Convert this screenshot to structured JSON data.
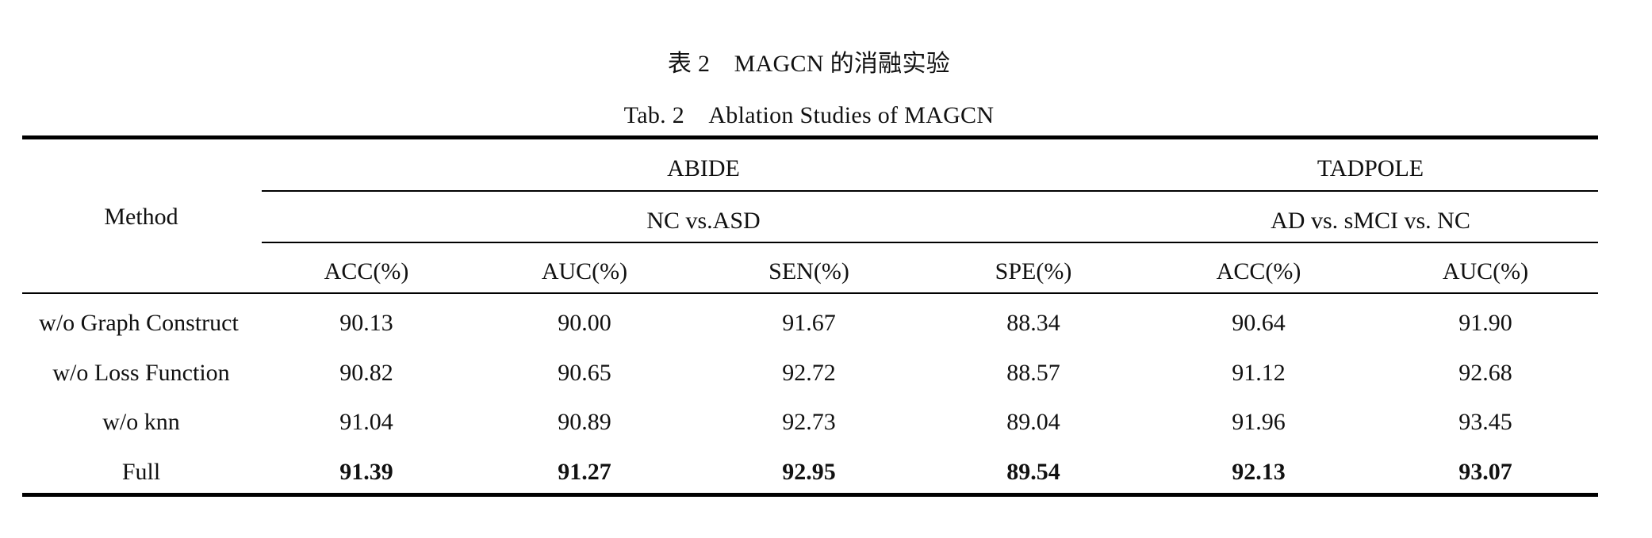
{
  "caption": {
    "chinese": "表 2　MAGCN 的消融实验",
    "english": "Tab. 2　Ablation Studies of MAGCN"
  },
  "table": {
    "method_header": "Method",
    "groups": [
      {
        "dataset": "ABIDE",
        "task": "NC vs.ASD",
        "metrics": [
          "ACC(%)",
          "AUC(%)",
          "SEN(%)",
          "SPE(%)"
        ]
      },
      {
        "dataset": "TADPOLE",
        "task": "AD vs. sMCI vs. NC",
        "metrics": [
          "ACC(%)",
          "AUC(%)"
        ]
      }
    ],
    "rows": [
      {
        "method": "w/o Graph Construct",
        "values": [
          "90.13",
          "90.00",
          "91.67",
          "88.34",
          "90.64",
          "91.90"
        ],
        "bold": false
      },
      {
        "method": "w/o Loss Function",
        "values": [
          "90.82",
          "90.65",
          "92.72",
          "88.57",
          "91.12",
          "92.68"
        ],
        "bold": false
      },
      {
        "method": "w/o knn",
        "values": [
          "91.04",
          "90.89",
          "92.73",
          "89.04",
          "91.96",
          "93.45"
        ],
        "bold": false
      },
      {
        "method": "Full",
        "values": [
          "91.39",
          "91.27",
          "92.95",
          "89.54",
          "92.13",
          "93.07"
        ],
        "bold": true
      }
    ]
  }
}
